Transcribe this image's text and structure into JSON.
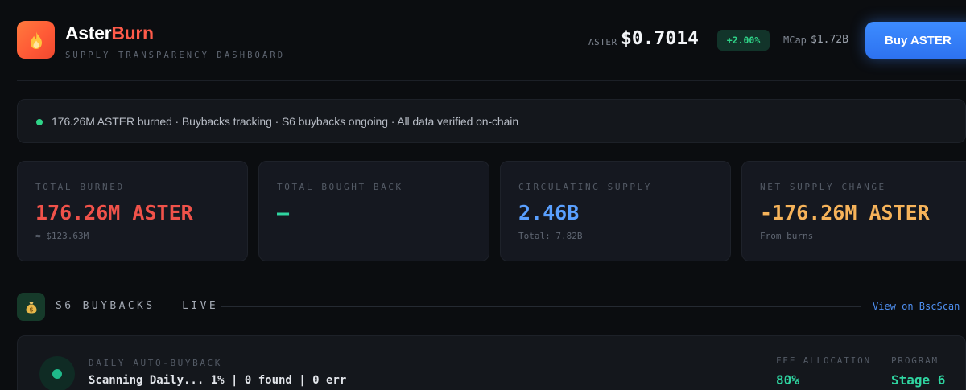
{
  "header": {
    "brand_part1": "Aster",
    "brand_part2": "Burn",
    "tagline": "SUPPLY TRANSPARENCY DASHBOARD",
    "price_label": "ASTER",
    "price": "$0.7014",
    "change": "+2.00%",
    "mcap_label": "MCap",
    "mcap_value": "$1.72B",
    "buy_button": "Buy ASTER",
    "logo_icon": "flame-icon"
  },
  "status": {
    "text": "176.26M ASTER burned · Buybacks tracking · S6 buybacks ongoing · All data verified on-chain",
    "dot_color": "#2fd488"
  },
  "cards": [
    {
      "label": "TOTAL BURNED",
      "value": "176.26M ASTER",
      "sub": "≈ $123.63M",
      "color": "#f0524a"
    },
    {
      "label": "TOTAL BOUGHT BACK",
      "value": "—",
      "sub": "",
      "color": "#2fd4a0"
    },
    {
      "label": "CIRCULATING SUPPLY",
      "value": "2.46B",
      "sub": "Total: 7.82B",
      "color": "#5aa0ff"
    },
    {
      "label": "NET SUPPLY CHANGE",
      "value": "-176.26M ASTER",
      "sub": "From burns",
      "color": "#f6b35a"
    }
  ],
  "section": {
    "icon": "money-bag-icon",
    "title": "S6 BUYBACKS — LIVE",
    "link": "View on BscScan"
  },
  "buyback": {
    "label": "DAILY AUTO-BUYBACK",
    "status": "Scanning Daily... 1% | 0 found | 0 err",
    "fee_label": "FEE ALLOCATION",
    "fee_value": "80%",
    "program_label": "PROGRAM",
    "program_value": "Stage 6"
  },
  "colors": {
    "background": "#0b0d10",
    "accent_blue": "#3d8cff",
    "positive": "#2fd488",
    "brand_red": "#ff5b4a"
  }
}
